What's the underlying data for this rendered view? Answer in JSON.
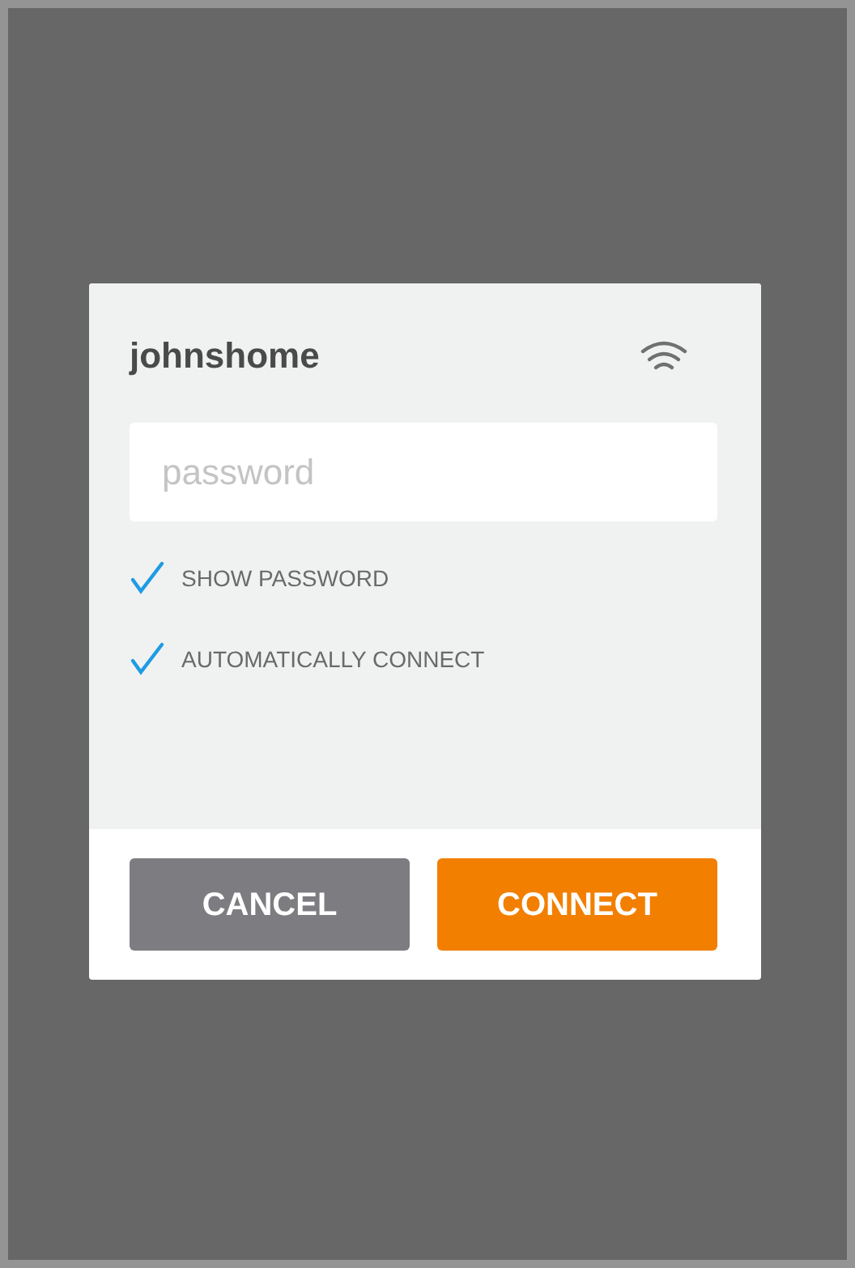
{
  "dialog": {
    "network_name": "johnshome",
    "password": {
      "placeholder": "password"
    },
    "options": [
      {
        "label": "SHOW PASSWORD",
        "checked": true
      },
      {
        "label": "AUTOMATICALLY CONNECT",
        "checked": true
      }
    ],
    "buttons": [
      {
        "label": "CANCEL",
        "kind": "secondary"
      },
      {
        "label": "CONNECT",
        "kind": "primary"
      }
    ]
  }
}
